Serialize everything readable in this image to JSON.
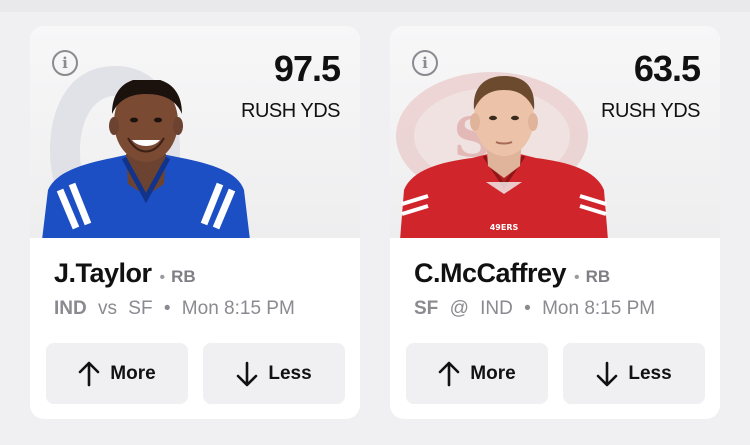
{
  "cards": [
    {
      "stat_value": "97.5",
      "stat_label": "RUSH YDS",
      "player_name": "J.Taylor",
      "position": "RB",
      "team": "IND",
      "matchup_sep": "vs",
      "opponent": "SF",
      "game_time": "Mon 8:15 PM",
      "jersey_color": "#1d4fc4",
      "more_label": "More",
      "less_label": "Less"
    },
    {
      "stat_value": "63.5",
      "stat_label": "RUSH YDS",
      "player_name": "C.McCaffrey",
      "position": "RB",
      "team": "SF",
      "matchup_sep": "@",
      "opponent": "IND",
      "game_time": "Mon 8:15 PM",
      "jersey_color": "#d0262b",
      "more_label": "More",
      "less_label": "Less"
    }
  ],
  "separator": "•",
  "icons": [
    "info-icon",
    "arrow-up-icon",
    "arrow-down-icon"
  ]
}
